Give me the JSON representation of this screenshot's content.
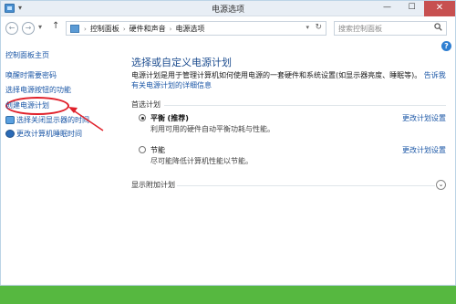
{
  "window": {
    "title": "电源选项",
    "quick_access": "▾",
    "minimize": "—",
    "maximize": "☐",
    "close": "✕"
  },
  "nav": {
    "back": "←",
    "forward": "→",
    "recent": "▾",
    "up": "↑",
    "breadcrumbs": [
      "控制面板",
      "硬件和声音",
      "电源选项"
    ],
    "crumb_sep": "›",
    "dropdown": "▾",
    "refresh": "↻",
    "search_placeholder": "搜索控制面板",
    "help": "?"
  },
  "sidebar": {
    "home": "控制面板主页",
    "items": [
      "唤醒时需要密码",
      "选择电源按钮的功能",
      "创建电源计划",
      "选择关闭显示器的时间",
      "更改计算机睡眠时间"
    ]
  },
  "main": {
    "title": "选择或自定义电源计划",
    "description": "电源计划是用于管理计算机如何使用电源的一套硬件和系统设置(如显示器亮度、睡眠等)。",
    "description_link": "告诉我有关电源计划的详细信息",
    "preferred_label": "首选计划",
    "plans": [
      {
        "name": "平衡",
        "tag": "(推荐)",
        "desc": "利用可用的硬件自动平衡功耗与性能。",
        "link": "更改计划设置",
        "selected": true
      },
      {
        "name": "节能",
        "tag": "",
        "desc": "尽可能降低计算机性能以节能。",
        "link": "更改计划设置",
        "selected": false
      }
    ],
    "extra_label": "显示附加计划",
    "expand": "⌄"
  },
  "colors": {
    "link": "#1a56a6",
    "title": "#1e4e90",
    "highlight": "#e0202a",
    "background": "#6ec24b"
  }
}
